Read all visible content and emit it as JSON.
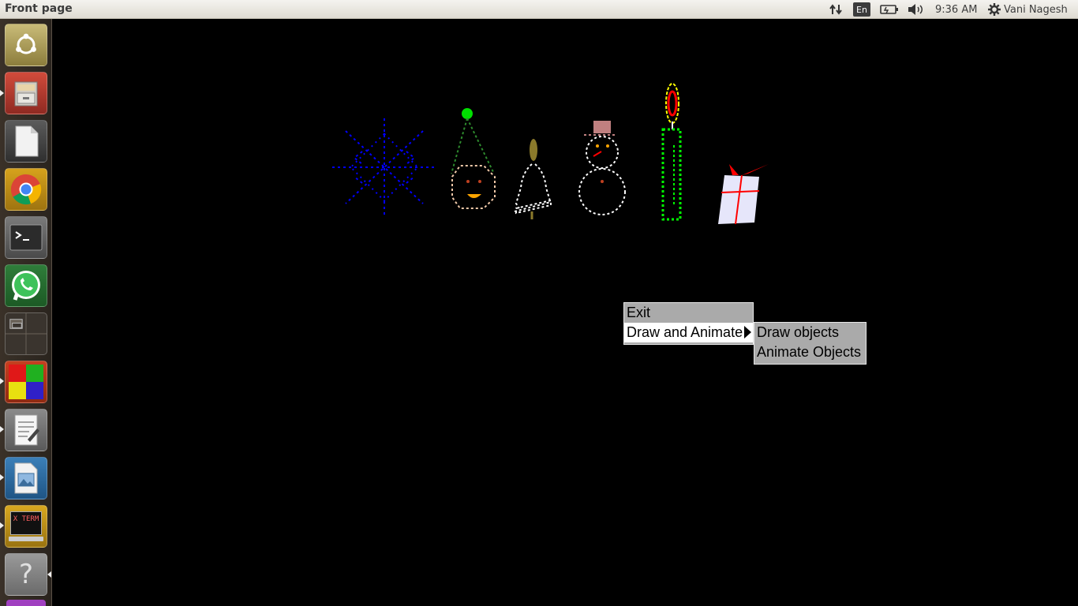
{
  "topbar": {
    "window_title": "Front page",
    "keyboard_layout": "En",
    "time": "9:36 AM",
    "user_name": "Vani Nagesh"
  },
  "launcher": {
    "items": [
      {
        "name": "ubuntu-dash-icon"
      },
      {
        "name": "files-icon"
      },
      {
        "name": "libreoffice-icon"
      },
      {
        "name": "chrome-icon"
      },
      {
        "name": "terminal-icon"
      },
      {
        "name": "whatsapp-icon"
      },
      {
        "name": "workspace-switcher-icon"
      },
      {
        "name": "color-cubes-icon"
      },
      {
        "name": "text-editor-icon"
      },
      {
        "name": "image-viewer-icon"
      },
      {
        "name": "xterm-icon",
        "label": "X TERM"
      },
      {
        "name": "help-icon",
        "label": "?"
      }
    ]
  },
  "scene": {
    "objects": [
      "snowflake",
      "party-hat-face",
      "bell",
      "snowman",
      "candle",
      "gift-box"
    ],
    "colors": {
      "snowflake": "#0000ff",
      "hat": "#2e8b2e",
      "hat_ball": "#00e000",
      "bell": "#ffffff",
      "bell_handle": "#8b7a2b",
      "candle_body": "#00ff00",
      "flame_outer": "#ffff00",
      "flame_inner": "#ff0000",
      "gift": "#e6e6fa",
      "ribbon": "#ff0000"
    }
  },
  "context_menu": {
    "items": [
      {
        "label": "Exit"
      },
      {
        "label": "Draw and Animate",
        "submenu": true
      }
    ],
    "submenu": {
      "items": [
        {
          "label": "Draw objects"
        },
        {
          "label": "Animate Objects"
        }
      ]
    }
  }
}
